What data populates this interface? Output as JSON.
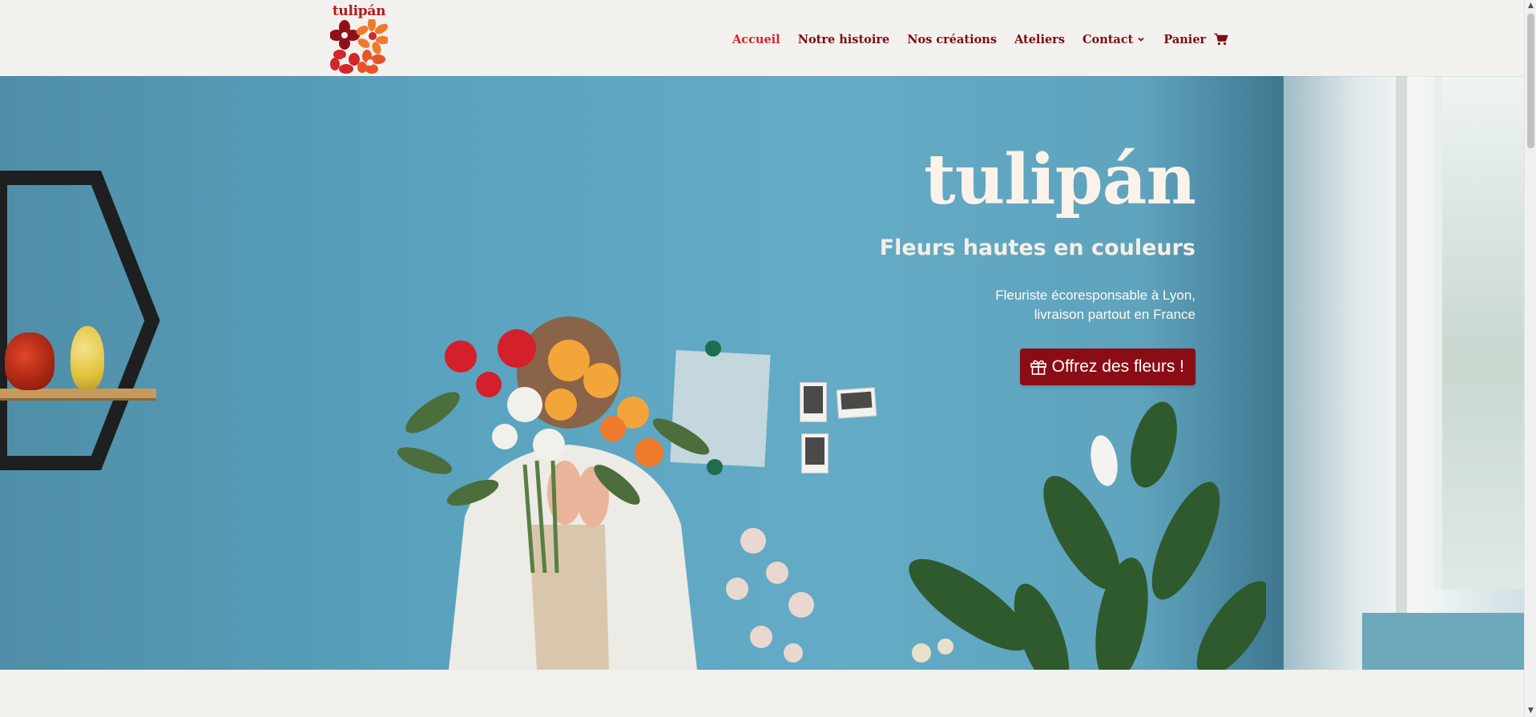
{
  "header": {
    "logo_text": "tulipán",
    "nav": [
      {
        "label": "Accueil",
        "active": true
      },
      {
        "label": "Notre histoire",
        "active": false
      },
      {
        "label": "Nos créations",
        "active": false
      },
      {
        "label": "Ateliers",
        "active": false
      },
      {
        "label": "Contact",
        "active": false,
        "has_dropdown": true
      },
      {
        "label": "Panier",
        "active": false,
        "icon": "cart-icon"
      }
    ]
  },
  "hero": {
    "title": "tulipán",
    "subtitle": "Fleurs hautes en couleurs",
    "description_line1": "Fleuriste écoresponsable à Lyon,",
    "description_line2": "livraison partout en France",
    "cta_label": "Offrez des fleurs !",
    "cta_icon": "gift-icon",
    "background_image": "florist-with-bouquet-photo"
  },
  "colors": {
    "page_bg": "#f3f1ed",
    "nav_text": "#7a0e14",
    "nav_active": "#d3262b",
    "cta_bg": "#8a0d16",
    "hero_text": "#fbf3ea",
    "wall_blue": "#5aa3bf"
  }
}
